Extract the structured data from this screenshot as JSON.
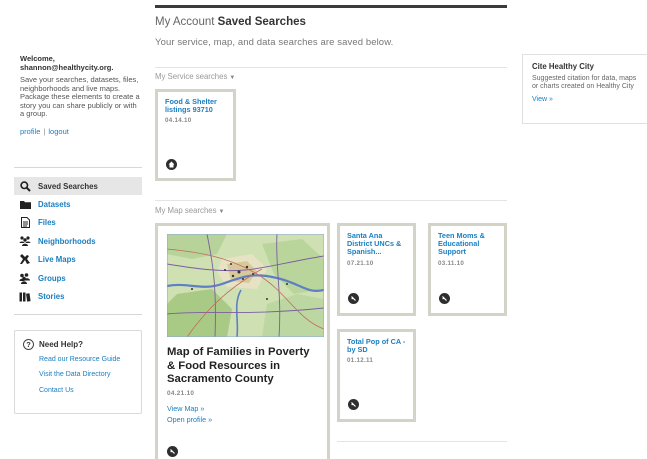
{
  "sidebar": {
    "welcome": "Welcome,",
    "username": "shannon@healthycity.org.",
    "description": "Save your searches, datasets, files, neighborhoods and live maps. Package these elements to create a story you can share publicly or with a group.",
    "profile_link": "profile",
    "separator": "|",
    "logout_link": "logout",
    "nav": [
      {
        "label": "Saved Searches",
        "icon": "search-icon",
        "active": true
      },
      {
        "label": "Datasets",
        "icon": "folder-icon",
        "active": false
      },
      {
        "label": "Files",
        "icon": "file-icon",
        "active": false
      },
      {
        "label": "Neighborhoods",
        "icon": "people-icon",
        "active": false
      },
      {
        "label": "Live Maps",
        "icon": "map-pin-icon",
        "active": false
      },
      {
        "label": "Groups",
        "icon": "group-icon",
        "active": false
      },
      {
        "label": "Stories",
        "icon": "book-icon",
        "active": false
      }
    ],
    "help": {
      "title": "Need Help?",
      "icon": "question-icon",
      "links": [
        "Read our Resource Guide",
        "Visit the Data Directory",
        "Contact Us"
      ]
    }
  },
  "main": {
    "breadcrumb": "My Account",
    "title": "Saved Searches",
    "subtitle": "Your service, map, and data searches are saved below.",
    "service_section": {
      "label": "My Service searches",
      "items": [
        {
          "title": "Food & Shelter listings 93710",
          "date": "04.14.10",
          "icon": "home-icon"
        }
      ]
    },
    "map_section": {
      "label": "My Map searches",
      "featured": {
        "title": "Map of Families in Poverty & Food Resources in Sacramento County",
        "date": "04.21.10",
        "view_link": "View Map »",
        "open_link": "Open profile »",
        "icon": "map-icon"
      },
      "items": [
        {
          "title": "Santa Ana District UNCs & Spanish...",
          "date": "07.21.10",
          "icon": "map-icon"
        },
        {
          "title": "Teen Moms & Educational Support",
          "date": "03.11.10",
          "icon": "map-icon"
        },
        {
          "title": "Total Pop of CA - by SD",
          "date": "01.12.11",
          "icon": "map-icon"
        }
      ]
    }
  },
  "cite": {
    "title": "Cite Healthy City",
    "description": "Suggested citation for data, maps or charts created on Healthy City",
    "view_link": "View »"
  },
  "colors": {
    "link": "#1a7fc1",
    "card_border": "#d3d3c8",
    "top_bar": "#3b3b3b"
  }
}
